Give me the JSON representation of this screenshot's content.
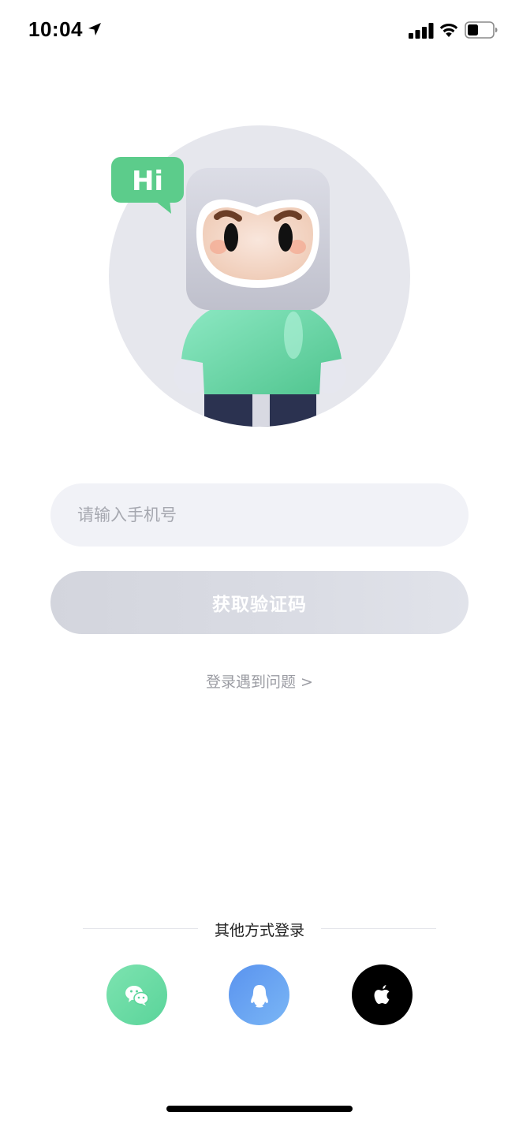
{
  "status_bar": {
    "time": "10:04"
  },
  "mascot": {
    "bubble_text": "Hi"
  },
  "login": {
    "phone_placeholder": "请输入手机号",
    "get_code_label": "获取验证码",
    "help_link": "登录遇到问题 >"
  },
  "other_login": {
    "title": "其他方式登录",
    "methods": [
      {
        "name": "wechat",
        "icon": "wechat-icon",
        "color": "#5ad49a"
      },
      {
        "name": "qq",
        "icon": "qq-penguin-icon",
        "color": "#5a93ef"
      },
      {
        "name": "apple",
        "icon": "apple-icon",
        "color": "#000000"
      }
    ]
  },
  "colors": {
    "accent_green": "#5ad49a",
    "input_bg": "#f1f2f7",
    "disabled_button": "#d9dbe3",
    "muted_text": "#9b9ca3"
  }
}
